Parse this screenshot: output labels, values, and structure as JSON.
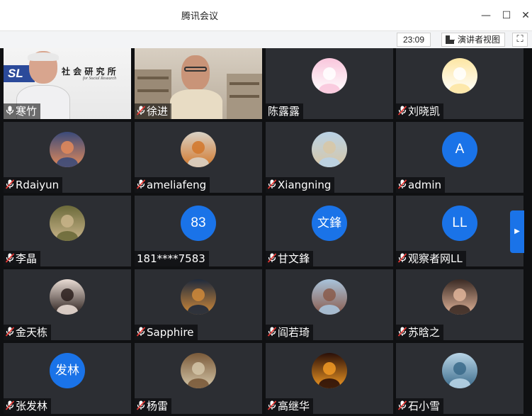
{
  "window": {
    "title": "腾讯会议",
    "minimize": "—",
    "maximize": "☐",
    "close": "✕"
  },
  "toolbar": {
    "timer": "23:09",
    "speaker_view_label": "演讲者视图",
    "fullscreen": "⛶"
  },
  "participants": [
    {
      "name": "寒竹",
      "mic": "on",
      "type": "video-office",
      "banner_text": "社 会 研 究 所",
      "banner_sub": "for Social Research",
      "banner_logo": "SL"
    },
    {
      "name": "徐进",
      "mic": "muted",
      "type": "video-room"
    },
    {
      "name": "陈露露",
      "mic": "none",
      "type": "avatar",
      "avatar_icon": "cartoon-bunny-icon",
      "colors": [
        "#f9c6dc",
        "#ffffff"
      ]
    },
    {
      "name": "刘晓凯",
      "mic": "muted",
      "type": "avatar",
      "avatar_icon": "cartoon-sheep-icon",
      "colors": [
        "#fde6a3",
        "#ffffff"
      ]
    },
    {
      "name": "Rdaiyun",
      "mic": "muted",
      "type": "avatar",
      "avatar_icon": "sunset-photo-icon",
      "colors": [
        "#3a4a7a",
        "#e38a5a"
      ]
    },
    {
      "name": "ameliafeng",
      "mic": "muted",
      "type": "avatar",
      "avatar_icon": "fox-photo-icon",
      "colors": [
        "#d9d2c6",
        "#d2772a"
      ]
    },
    {
      "name": "Xiangning",
      "mic": "muted",
      "type": "avatar",
      "avatar_icon": "beach-photo-icon",
      "colors": [
        "#b9d2e6",
        "#d8c7a6"
      ]
    },
    {
      "name": "admin",
      "mic": "muted",
      "type": "letter",
      "letter": "A"
    },
    {
      "name": "李晶",
      "mic": "muted",
      "type": "avatar",
      "avatar_icon": "woman-flowers-photo-icon",
      "colors": [
        "#6b6a3a",
        "#c9b48a"
      ]
    },
    {
      "name": "181****7583",
      "mic": "none",
      "type": "letter",
      "letter": "83"
    },
    {
      "name": "甘文鋒",
      "mic": "muted",
      "type": "letter",
      "letter": "文鋒"
    },
    {
      "name": "观察者网LL",
      "mic": "muted",
      "type": "letter",
      "letter": "LL"
    },
    {
      "name": "金天栋",
      "mic": "muted",
      "type": "avatar",
      "avatar_icon": "woman-portrait-icon",
      "colors": [
        "#e9dcd4",
        "#2a1f1c"
      ]
    },
    {
      "name": "Sapphire",
      "mic": "muted",
      "type": "avatar",
      "avatar_icon": "night-street-photo-icon",
      "colors": [
        "#1f2a3c",
        "#d08a3a"
      ]
    },
    {
      "name": "阎若琦",
      "mic": "muted",
      "type": "avatar",
      "avatar_icon": "girl-scenery-photo-icon",
      "colors": [
        "#a9c4dc",
        "#8a5a4a"
      ]
    },
    {
      "name": "苏晗之",
      "mic": "muted",
      "type": "avatar",
      "avatar_icon": "child-portrait-icon",
      "colors": [
        "#3a2a24",
        "#e2b59a"
      ]
    },
    {
      "name": "张发林",
      "mic": "muted",
      "type": "letter",
      "letter": "发林"
    },
    {
      "name": "杨雷",
      "mic": "muted",
      "type": "avatar",
      "avatar_icon": "bookshelf-photo-icon",
      "colors": [
        "#7a5a3a",
        "#d4c6a8"
      ]
    },
    {
      "name": "高继华",
      "mic": "muted",
      "type": "avatar",
      "avatar_icon": "fire-circle-icon",
      "colors": [
        "#2a0f08",
        "#f29a24"
      ]
    },
    {
      "name": "石小雪",
      "mic": "muted",
      "type": "avatar",
      "avatar_icon": "blue-painting-icon",
      "colors": [
        "#b8d4e6",
        "#3a6a8a"
      ]
    }
  ],
  "side_arrow": "▶",
  "colors": {
    "accent": "#1a73e8",
    "tile_bg": "#2c2e33",
    "mute_red": "#e53935"
  }
}
